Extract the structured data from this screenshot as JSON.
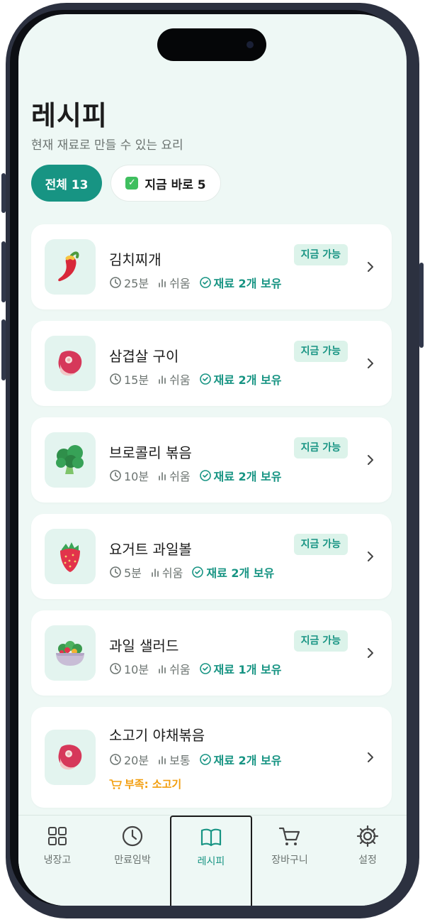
{
  "page": {
    "title": "레시피",
    "subtitle": "현재 재료로 만들 수 있는 요리"
  },
  "filters": {
    "all": "전체 13",
    "now": "지금 바로 5"
  },
  "recipes": [
    {
      "name": "김치찌개",
      "time": "25분",
      "level": "쉬움",
      "own": "재료 2개 보유",
      "badge": "지금 가능",
      "icon": "chili-pepper-icon"
    },
    {
      "name": "삼겹살 구이",
      "time": "15분",
      "level": "쉬움",
      "own": "재료 2개 보유",
      "badge": "지금 가능",
      "icon": "meat-icon"
    },
    {
      "name": "브로콜리 볶음",
      "time": "10분",
      "level": "쉬움",
      "own": "재료 2개 보유",
      "badge": "지금 가능",
      "icon": "broccoli-icon"
    },
    {
      "name": "요거트 과일볼",
      "time": "5분",
      "level": "쉬움",
      "own": "재료 2개 보유",
      "badge": "지금 가능",
      "icon": "strawberry-icon"
    },
    {
      "name": "과일 샐러드",
      "time": "10분",
      "level": "쉬움",
      "own": "재료 1개 보유",
      "badge": "지금 가능",
      "icon": "salad-bowl-icon"
    },
    {
      "name": "소고기 야채볶음",
      "time": "20분",
      "level": "보통",
      "own": "재료 2개 보유",
      "missing": "부족: 소고기",
      "icon": "meat-icon"
    }
  ],
  "tabs": [
    {
      "label": "냉장고",
      "icon": "grid-icon"
    },
    {
      "label": "만료임박",
      "icon": "clock-icon"
    },
    {
      "label": "레시피",
      "icon": "book-icon",
      "active": true
    },
    {
      "label": "장바구니",
      "icon": "cart-icon"
    },
    {
      "label": "설정",
      "icon": "gear-icon"
    }
  ],
  "colors": {
    "accent": "#179483",
    "badge_bg": "#dcf3ea",
    "warning": "#f29d0c",
    "background": "#eef8f5"
  }
}
